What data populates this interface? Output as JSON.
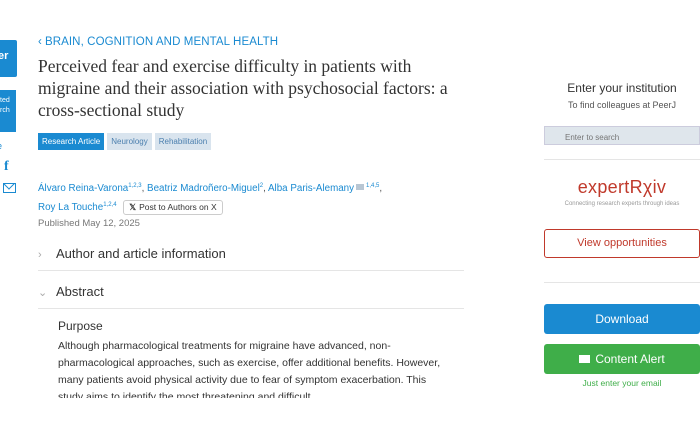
{
  "left_sidebar": {
    "logo_text": "er",
    "logo_sub": "...",
    "submit_text_1": "ted",
    "submit_text_2": "rch",
    "share_label": "re"
  },
  "breadcrumb": {
    "chevron": "‹",
    "label": "BRAIN, COGNITION AND MENTAL HEALTH"
  },
  "article": {
    "title": "Perceived fear and exercise difficulty in patients with migraine and their association with psychosocial factors: a cross-sectional study",
    "tags": [
      "Research Article",
      "Neurology",
      "Rehabilitation"
    ],
    "authors": [
      {
        "name": "Álvaro Reina-Varona",
        "sup": "1,2,3"
      },
      {
        "name": "Beatriz Madroñero-Miguel",
        "sup": "2"
      },
      {
        "name": "Alba Paris-Alemany",
        "sup": "1,4,5"
      },
      {
        "name": "Roy La Touche",
        "sup": "1,2,4"
      }
    ],
    "post_to_authors": "Post to Authors on X",
    "published": "Published May 12, 2025",
    "sections": {
      "author_info": "Author and article information",
      "abstract": "Abstract"
    },
    "purpose_heading": "Purpose",
    "abstract_text": "Although pharmacological treatments for migraine have advanced, non-pharmacological approaches, such as exercise, offer additional benefits. However, many patients avoid physical activity due to fear of symptom exacerbation. This study aims to identify the most threatening and difficult"
  },
  "sidebar": {
    "institution_title": "Enter your institution",
    "institution_sub": "To find colleagues at PeerJ",
    "institution_placeholder": "Enter to search",
    "expertrxiv_logo": "expertRχiv",
    "expertrxiv_tagline": "Connecting research experts through ideas",
    "view_opportunities": "View opportunities",
    "download": "Download",
    "content_alert": "Content Alert",
    "alert_hint": "Just enter your email"
  },
  "colors": {
    "brand_blue": "#1a8ad1",
    "green": "#3fae49",
    "expert_red": "#c0392b"
  }
}
